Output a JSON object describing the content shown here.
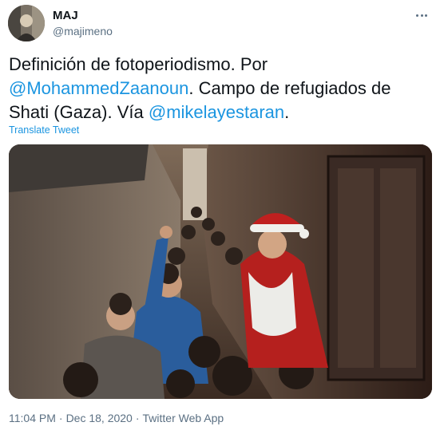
{
  "user": {
    "display_name": "MAJ",
    "handle": "@majimeno"
  },
  "more_icon": "more-horizontal-icon",
  "tweet": {
    "text_1": "Definición de fotoperiodismo. Por ",
    "mention_1": "@MohammedZaanoun",
    "text_2": ". Campo de refugiados de Shati (Gaza). Vía ",
    "mention_2": "@mikelayestaran",
    "text_3": ".",
    "translate_label": "Translate Tweet"
  },
  "meta": {
    "time": "11:04 PM",
    "separator": "·",
    "date": "Dec 18, 2020",
    "source": "Twitter Web App"
  },
  "colors": {
    "link": "#1b95e0",
    "secondary_text": "#5b7083",
    "primary_text": "#0f1419"
  }
}
